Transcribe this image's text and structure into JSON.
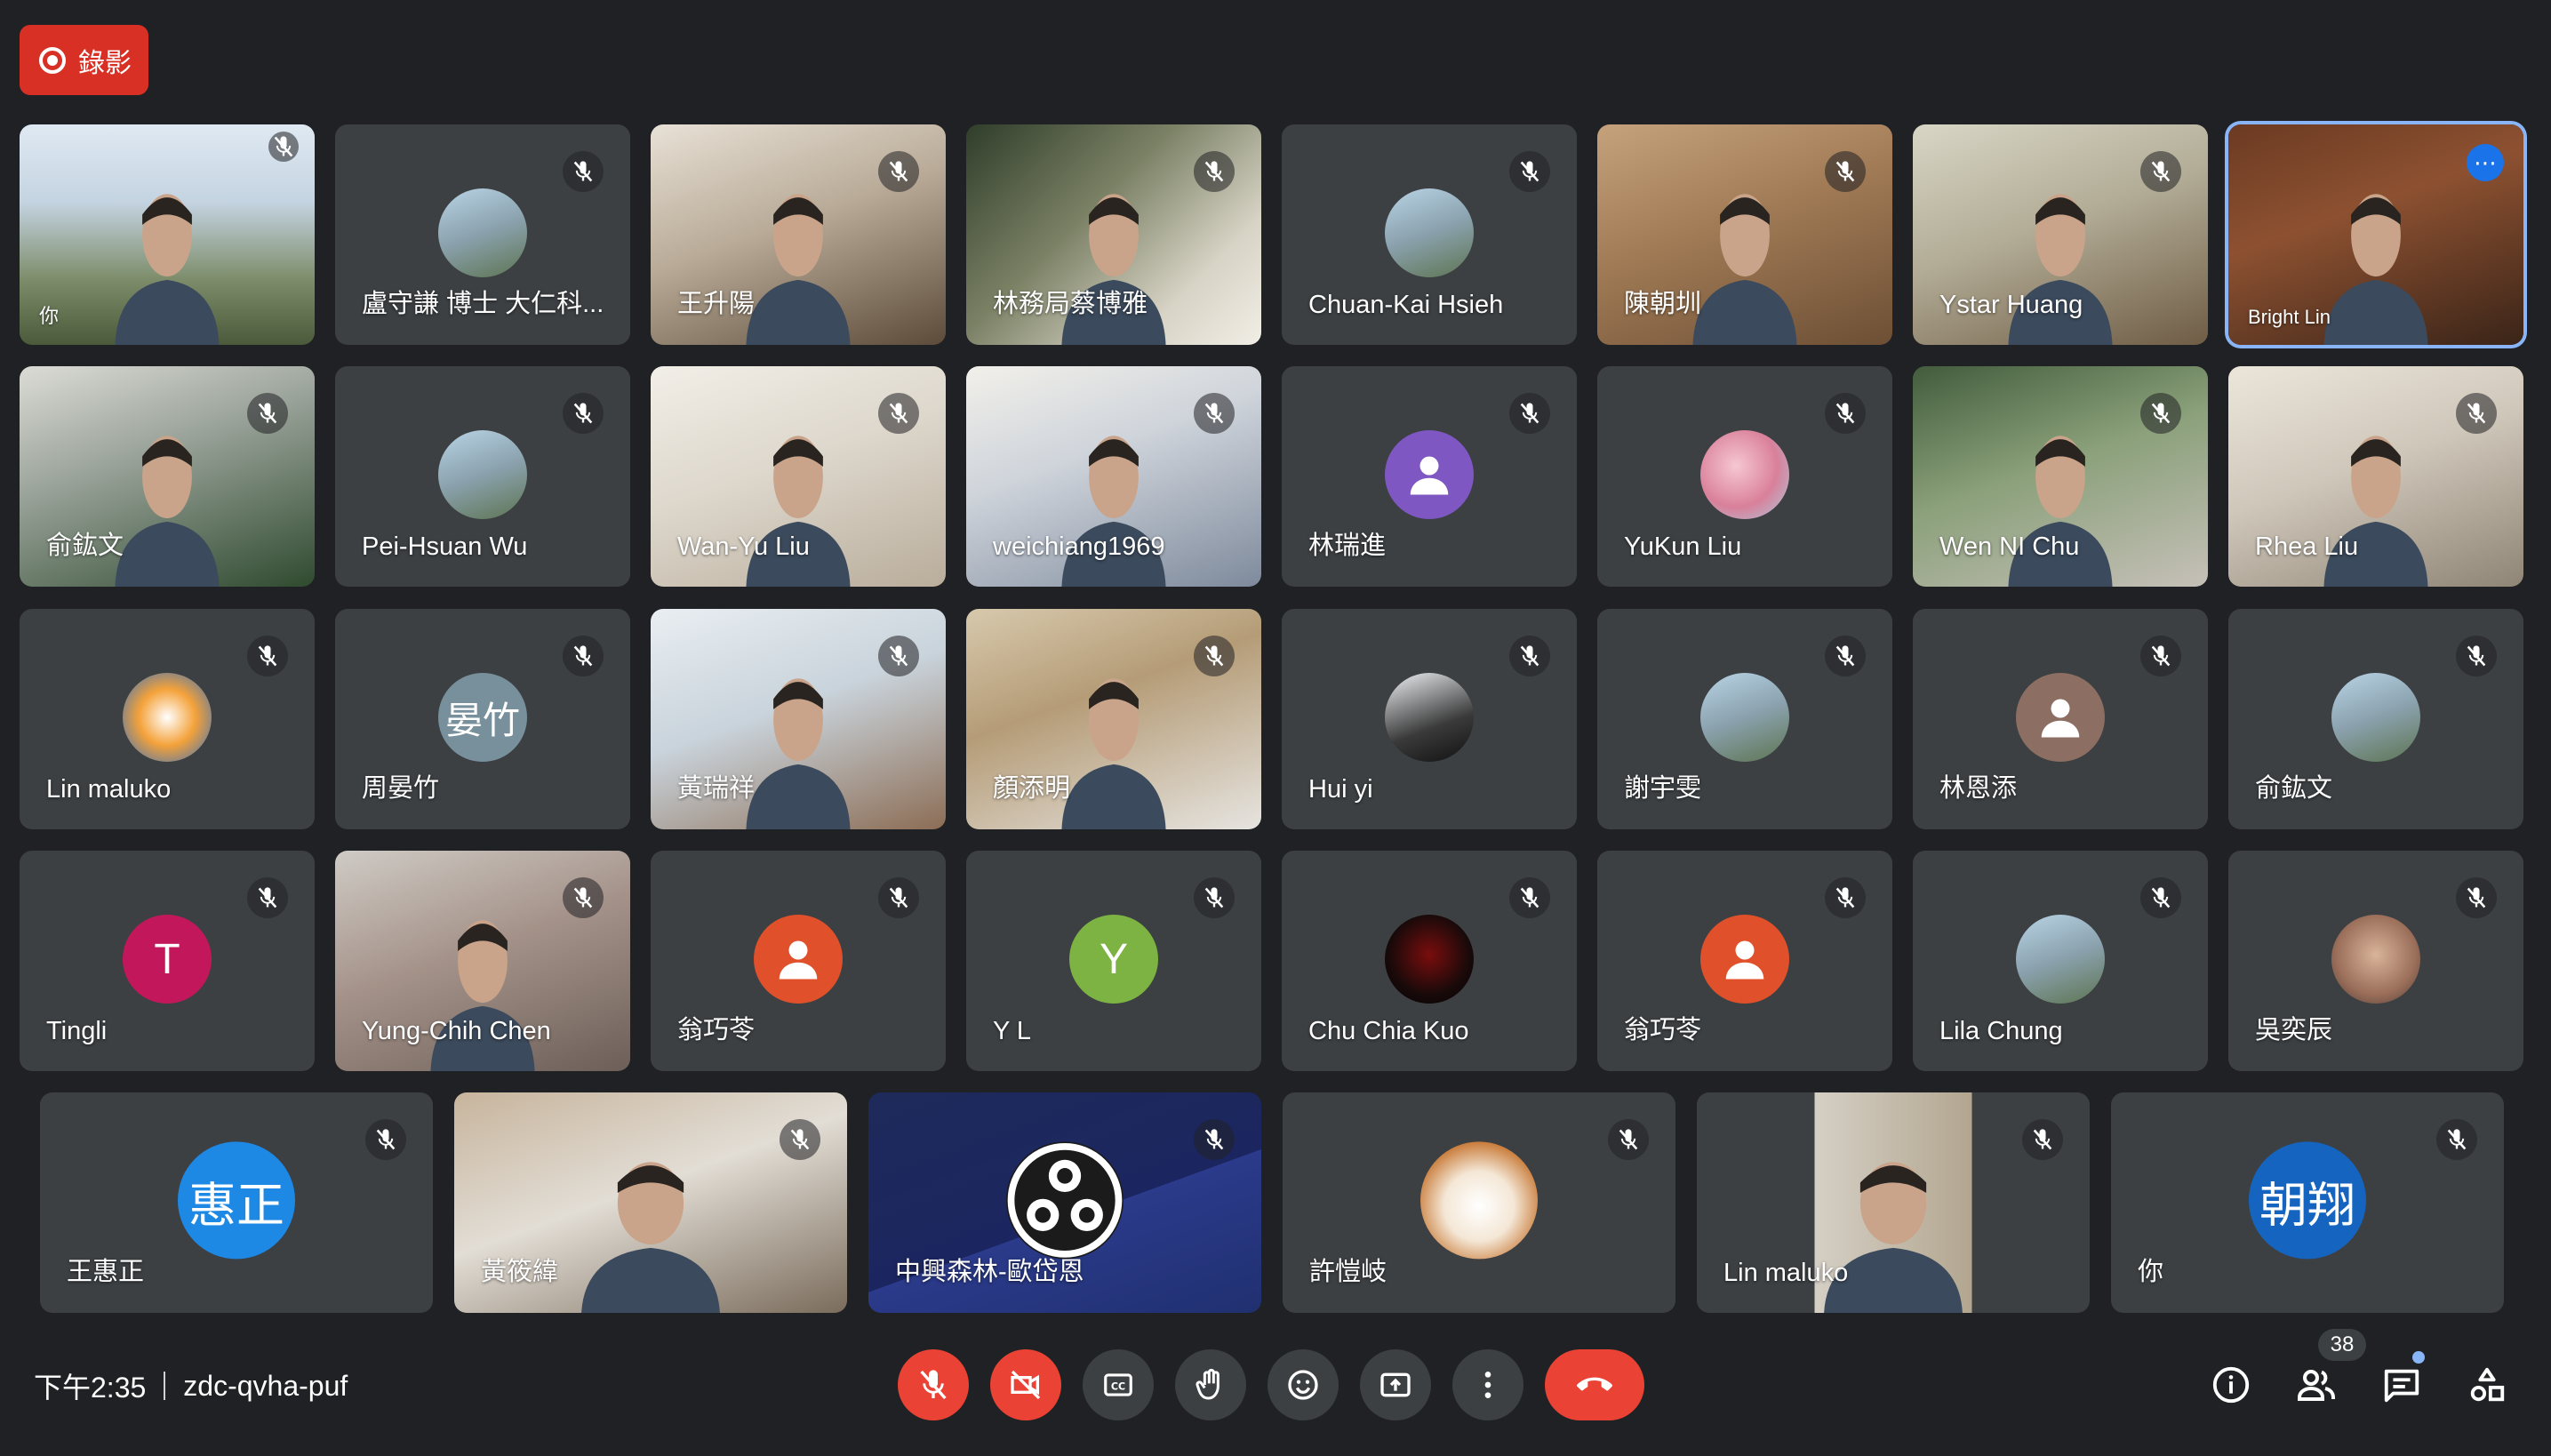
{
  "recording": {
    "label": "錄影"
  },
  "meeting": {
    "time": "下午2:35",
    "code": "zdc-qvha-puf"
  },
  "participants_count": "38",
  "rows": [
    [
      {
        "name": "你",
        "type": "video"
      },
      {
        "name": "盧守謙 博士 大仁科...",
        "type": "avatar",
        "avatar_kind": "photo"
      },
      {
        "name": "王升陽",
        "type": "video"
      },
      {
        "name": "林務局蔡博雅",
        "type": "video"
      },
      {
        "name": "Chuan-Kai Hsieh",
        "type": "avatar",
        "avatar_kind": "photo"
      },
      {
        "name": "陳朝圳",
        "type": "video"
      },
      {
        "name": "Ystar Huang",
        "type": "video"
      },
      {
        "name": "Bright Lin",
        "type": "video"
      }
    ],
    [
      {
        "name": "俞鈜文",
        "type": "video"
      },
      {
        "name": "Pei-Hsuan Wu",
        "type": "avatar",
        "avatar_kind": "photo"
      },
      {
        "name": "Wan-Yu Liu",
        "type": "video"
      },
      {
        "name": "weichiang1969",
        "type": "video"
      },
      {
        "name": "林瑞進",
        "type": "avatar",
        "avatar_kind": "default-purple"
      },
      {
        "name": "YuKun Liu",
        "type": "avatar",
        "avatar_kind": "photo-pink"
      },
      {
        "name": "Wen NI Chu",
        "type": "video"
      },
      {
        "name": "Rhea Liu",
        "type": "video"
      }
    ],
    [
      {
        "name": "Lin maluko",
        "type": "avatar",
        "avatar_kind": "cartoon"
      },
      {
        "name": "周晏竹",
        "type": "avatar",
        "avatar_kind": "initials",
        "initials": "晏竹"
      },
      {
        "name": "黃瑞祥",
        "type": "video"
      },
      {
        "name": "顏添明",
        "type": "video"
      },
      {
        "name": "Hui yi",
        "type": "avatar",
        "avatar_kind": "photo-dark"
      },
      {
        "name": "謝宇雯",
        "type": "avatar",
        "avatar_kind": "photo"
      },
      {
        "name": "林恩添",
        "type": "avatar",
        "avatar_kind": "default-gray"
      },
      {
        "name": "俞鈜文",
        "type": "avatar",
        "avatar_kind": "photo"
      }
    ],
    [
      {
        "name": "Tingli",
        "type": "avatar",
        "avatar_kind": "initials",
        "initials": "T"
      },
      {
        "name": "Yung-Chih Chen",
        "type": "video"
      },
      {
        "name": "翁巧苓",
        "type": "avatar",
        "avatar_kind": "default-orange"
      },
      {
        "name": "Y L",
        "type": "avatar",
        "avatar_kind": "initials",
        "initials": "Y"
      },
      {
        "name": "Chu Chia Kuo",
        "type": "avatar",
        "avatar_kind": "photo-black"
      },
      {
        "name": "翁巧苓",
        "type": "avatar",
        "avatar_kind": "default-orange"
      },
      {
        "name": "Lila Chung",
        "type": "avatar",
        "avatar_kind": "photo"
      },
      {
        "name": "吳奕辰",
        "type": "avatar",
        "avatar_kind": "photo-face"
      }
    ],
    [
      {
        "name": "王惠正",
        "type": "avatar",
        "avatar_kind": "initials",
        "initials": "惠正"
      },
      {
        "name": "黃筱緯",
        "type": "video"
      },
      {
        "name": "中興森林-歐岱恩",
        "type": "avatar",
        "avatar_kind": "obs"
      },
      {
        "name": "許愷岐",
        "type": "avatar",
        "avatar_kind": "dog"
      },
      {
        "name": "Lin maluko",
        "type": "video"
      },
      {
        "name": "你",
        "type": "avatar",
        "avatar_kind": "initials",
        "initials": "朝翔"
      }
    ]
  ],
  "colors": {
    "background": "#202124",
    "tile": "#3c4043",
    "record": "#d93025",
    "end_call": "#ea4335",
    "accent_blue": "#1a73e8",
    "purple": "#7e57c2",
    "pink": "#c2185b",
    "green": "#7cb342",
    "orange": "#e0502a",
    "blue_initials": "#1e88e5",
    "slate": "#78909c"
  },
  "controls": {
    "mic": "mic-off-icon",
    "camera": "camera-off-icon",
    "captions": "captions-icon",
    "raise_hand": "raise-hand-icon",
    "reactions": "emoji-icon",
    "present": "present-icon",
    "more": "more-vert-icon",
    "leave": "end-call-icon",
    "info": "info-icon",
    "people": "people-icon",
    "chat": "chat-icon",
    "activities": "activities-icon"
  }
}
